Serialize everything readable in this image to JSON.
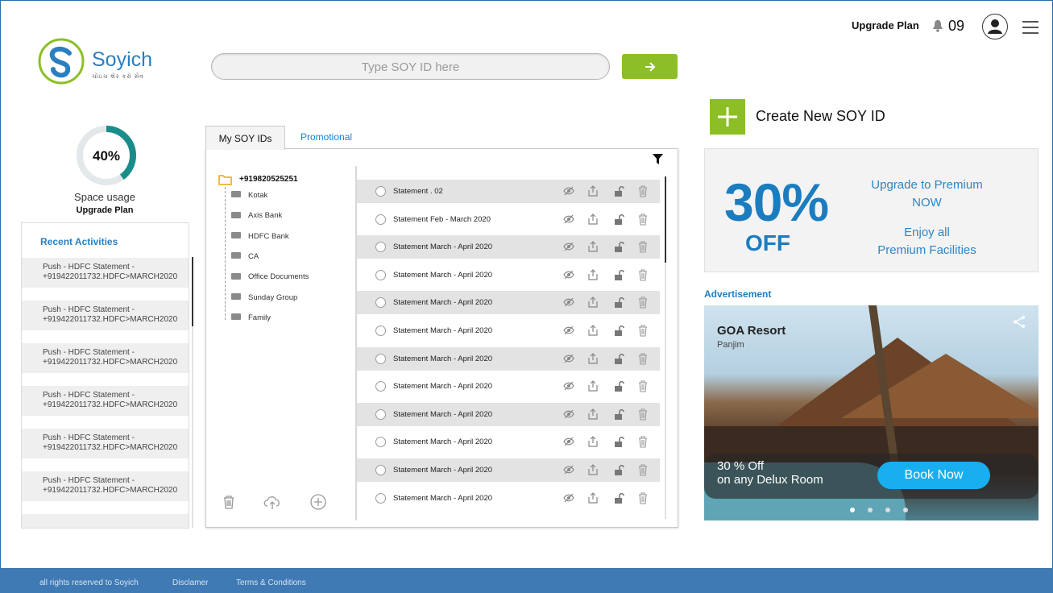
{
  "brand": {
    "name": "Soyich",
    "tagline": "ચોઇચ શેર કરો સેવ",
    "colors": {
      "accent": "#8cbf26",
      "primary": "#1b7dc0",
      "footer": "#3f7ab4"
    }
  },
  "header": {
    "search_placeholder": "Type SOY ID here",
    "go_icon": "arrow-right-icon",
    "upgrade_label": "Upgrade Plan",
    "notification_count": "09",
    "icons": [
      "bell-icon",
      "user-avatar-icon",
      "hamburger-menu-icon"
    ]
  },
  "space": {
    "percent_label": "40%",
    "fraction": 0.4,
    "label": "Space usage",
    "plan": "Upgrade Plan"
  },
  "recent": {
    "title": "Recent Activities",
    "items": [
      {
        "line1": "Push - HDFC Statement -",
        "line2": "+919422011732.HDFC>MARCH2020"
      },
      {
        "line1": "Push - HDFC Statement -",
        "line2": "+919422011732.HDFC>MARCH2020"
      },
      {
        "line1": "Push - HDFC Statement -",
        "line2": "+919422011732.HDFC>MARCH2020"
      },
      {
        "line1": "Push - HDFC Statement -",
        "line2": "+919422011732.HDFC>MARCH2020"
      },
      {
        "line1": "Push - HDFC Statement -",
        "line2": "+919422011732.HDFC>MARCH2020"
      },
      {
        "line1": "Push - HDFC Statement -",
        "line2": "+919422011732.HDFC>MARCH2020"
      }
    ]
  },
  "tabs": {
    "active": "My SOY IDs",
    "other": "Promotional"
  },
  "tree": {
    "root": "+919820525251",
    "folders": [
      "Kotak",
      "Axis Bank",
      "HDFC Bank",
      "CA",
      "Office Documents",
      "Sunday Group",
      "Family"
    ]
  },
  "files": [
    "Statement . 02",
    "Statement Feb - March 2020",
    "Statement March - April 2020",
    "Statement March - April 2020",
    "Statement March - April 2020",
    "Statement March - April 2020",
    "Statement March - April 2020",
    "Statement March - April 2020",
    "Statement March - April 2020",
    "Statement March - April 2020",
    "Statement March - April 2020",
    "Statement March - April 2020"
  ],
  "file_actions": [
    "hide-icon",
    "share-icon",
    "unlock-icon",
    "delete-icon"
  ],
  "panel_bottom_icons": [
    "trash-icon",
    "cloud-upload-icon",
    "add-circle-icon"
  ],
  "create": {
    "label": "Create New SOY ID"
  },
  "promo": {
    "percent": "30%",
    "off": "OFF",
    "line1": "Upgrade to Premium",
    "line2": "NOW",
    "line3": "Enjoy all",
    "line4": "Premium Facilities"
  },
  "ad": {
    "label": "Advertisement",
    "title": "GOA Resort",
    "subtitle": "Panjim",
    "offer1": "30 % Off",
    "offer2": "on any Delux Room",
    "button": "Book Now"
  },
  "footer": {
    "rights": "all rights reserved to Soyich",
    "disclaimer": "Disclamer",
    "terms": "Terms & Conditions"
  }
}
